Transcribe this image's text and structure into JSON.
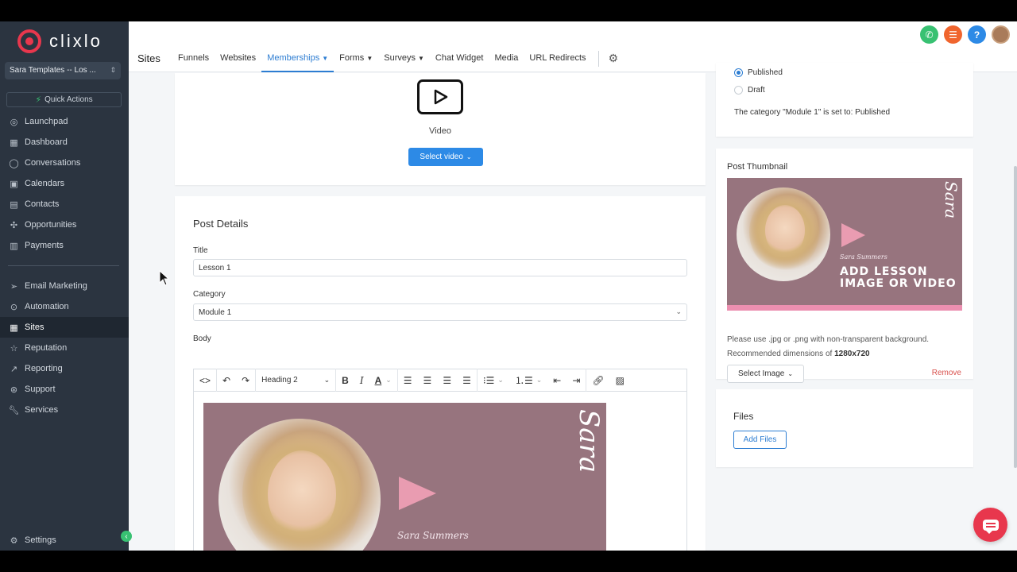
{
  "app": {
    "logo_text": "clixlo",
    "account_name": "Sara Templates -- Los ...",
    "quick_actions": "Quick Actions"
  },
  "sidebar": {
    "items_top": [
      {
        "label": "Launchpad",
        "icon": "rocket-icon"
      },
      {
        "label": "Dashboard",
        "icon": "dashboard-icon"
      },
      {
        "label": "Conversations",
        "icon": "chat-icon"
      },
      {
        "label": "Calendars",
        "icon": "calendar-icon"
      },
      {
        "label": "Contacts",
        "icon": "contacts-icon"
      },
      {
        "label": "Opportunities",
        "icon": "opportunities-icon"
      },
      {
        "label": "Payments",
        "icon": "payments-icon"
      }
    ],
    "items_bottom": [
      {
        "label": "Email Marketing",
        "icon": "send-icon"
      },
      {
        "label": "Automation",
        "icon": "automation-icon"
      },
      {
        "label": "Sites",
        "icon": "sites-icon",
        "active": true
      },
      {
        "label": "Reputation",
        "icon": "star-icon"
      },
      {
        "label": "Reporting",
        "icon": "chart-icon"
      },
      {
        "label": "Support",
        "icon": "support-icon"
      },
      {
        "label": "Services",
        "icon": "wrench-icon"
      }
    ],
    "settings_label": "Settings"
  },
  "header": {
    "page_title": "Sites",
    "tabs": [
      {
        "label": "Funnels"
      },
      {
        "label": "Websites"
      },
      {
        "label": "Memberships",
        "active": true,
        "dropdown": true
      },
      {
        "label": "Forms",
        "dropdown": true
      },
      {
        "label": "Surveys",
        "dropdown": true
      },
      {
        "label": "Chat Widget"
      },
      {
        "label": "Media"
      },
      {
        "label": "URL Redirects"
      }
    ],
    "colors": {
      "phone": "#38c172",
      "list": "#f0652e",
      "help": "#2d8ae6"
    }
  },
  "video": {
    "label": "Video",
    "select_button": "Select video"
  },
  "post_details": {
    "heading": "Post Details",
    "title_label": "Title",
    "title_value": "Lesson 1",
    "category_label": "Category",
    "category_value": "Module 1",
    "body_label": "Body",
    "heading_select": "Heading 2"
  },
  "lesson_image": {
    "script_name": "Sara Summers",
    "headline_1": "ADD LESSON",
    "headline_2": "IMAGE OR VIDEO",
    "signature": "Sara",
    "colors": {
      "background": "#97747e",
      "accent": "#ec8fb0"
    }
  },
  "status": {
    "options": [
      {
        "label": "Published",
        "selected": true
      },
      {
        "label": "Draft",
        "selected": false
      }
    ],
    "note": "The category \"Module 1\" is set to: Published"
  },
  "thumbnail": {
    "heading": "Post Thumbnail",
    "hint": "Please use .jpg or .png with non-transparent background.",
    "dims_prefix": "Recommended dimensions of",
    "dims_value": "1280x720",
    "select_button": "Select Image",
    "remove": "Remove"
  },
  "files": {
    "heading": "Files",
    "add_button": "Add Files"
  }
}
